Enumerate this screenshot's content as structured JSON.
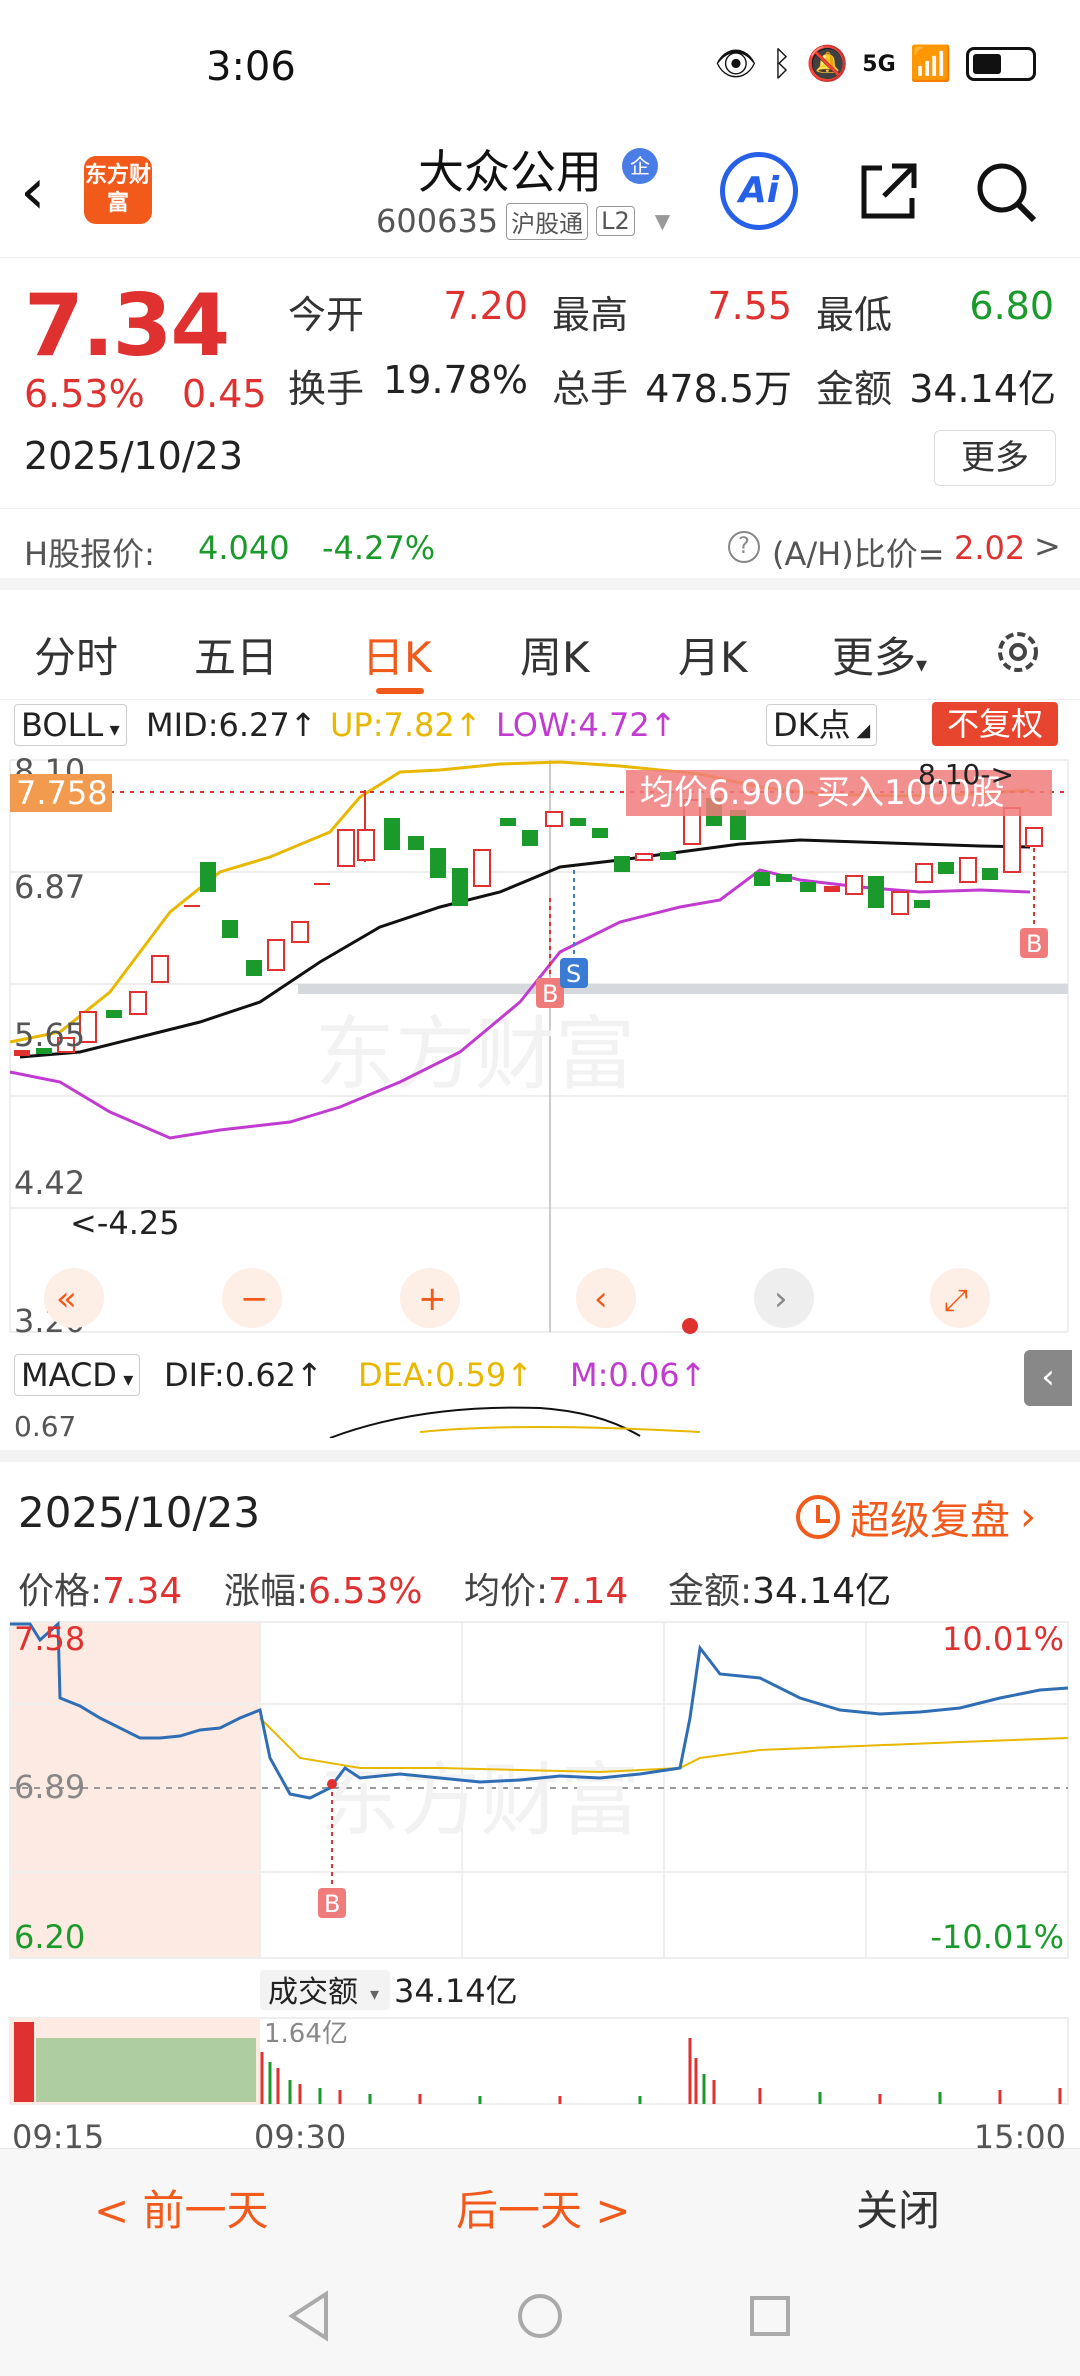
{
  "status_bar": {
    "time": "3:06",
    "network": "5G"
  },
  "header": {
    "logo_text": "东方财富",
    "stock_name": "大众公用",
    "badge": "企",
    "stock_code": "600635",
    "tag1": "沪股通",
    "tag2": "L2",
    "ai_label": "Ai"
  },
  "quote": {
    "price": "7.34",
    "change_pct": "6.53%",
    "change": "0.45",
    "date": "2025/10/23",
    "open_label": "今开",
    "open": "7.20",
    "high_label": "最高",
    "high": "7.55",
    "low_label": "最低",
    "low": "6.80",
    "turnover_label": "换手",
    "turnover": "19.78%",
    "volume_label": "总手",
    "volume": "478.5万",
    "amount_label": "金额",
    "amount": "34.14亿",
    "more_label": "更多"
  },
  "h_share": {
    "label": "H股报价:",
    "price": "4.040",
    "pct": "-4.27%",
    "ratio_label": "(A/H)比价=",
    "ratio": "2.02",
    "chevron": ">"
  },
  "tabs": [
    {
      "label": "分时"
    },
    {
      "label": "五日"
    },
    {
      "label": "日K"
    },
    {
      "label": "周K"
    },
    {
      "label": "月K"
    },
    {
      "label": "更多"
    }
  ],
  "kline": {
    "indicator": "BOLL",
    "mid": "MID:6.27↑",
    "up": "UP:7.82↑",
    "low": "LOW:4.72↑",
    "dk_label": "DK点",
    "fuquan_label": "不复权",
    "y_labels": [
      "8.10",
      "6.87",
      "5.65",
      "4.42",
      "3.20"
    ],
    "current_tag": "7.758",
    "avg_banner": "均价6.900  买入1000股",
    "max_label": "8.10->",
    "min_label": "<-4.25",
    "watermark": "东方财富",
    "marker_b": "B",
    "marker_s": "S",
    "colors": {
      "up": "#e03131",
      "down": "#1a9a2a",
      "mid": "#111111",
      "upper": "#e8b800",
      "lower": "#c23bd0"
    }
  },
  "macd": {
    "indicator": "MACD",
    "dif": "DIF:0.62↑",
    "dea": "DEA:0.59↑",
    "m": "M:0.06↑",
    "y_top": "0.67"
  },
  "minute": {
    "date": "2025/10/23",
    "replay_label": "超级复盘",
    "price_label": "价格:",
    "price": "7.34",
    "pct_label": "涨幅:",
    "pct": "6.53%",
    "avg_label": "均价:",
    "avg": "7.14",
    "amount_label": "金额:",
    "amount": "34.14亿",
    "y_top": "7.58",
    "y_mid": "6.89",
    "y_bottom": "6.20",
    "pct_top": "10.01%",
    "pct_bottom": "-10.01%",
    "volume_select": "成交额",
    "volume_total": "34.14亿",
    "volume_peak": "1.64亿",
    "time_start": "09:15",
    "time_open": "09:30",
    "time_end": "15:00",
    "marker_b": "B",
    "watermark": "东方财富"
  },
  "day_nav": {
    "prev": "< 前一天",
    "next": "后一天 >",
    "close": "关闭"
  }
}
